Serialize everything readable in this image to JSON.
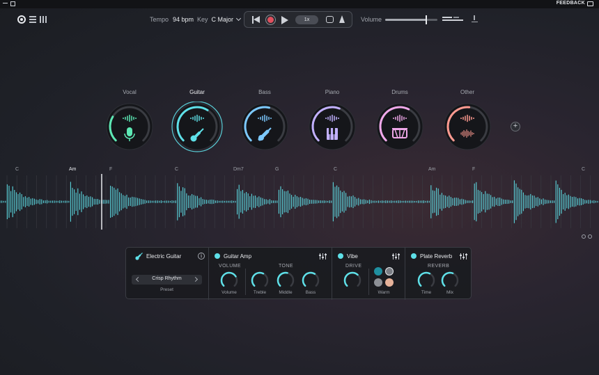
{
  "colors": {
    "accent_cyan": "#5ee0e8",
    "record_red": "#e0505e",
    "vocal": "#5de8b4",
    "guitar": "#5ee0e8",
    "bass": "#7cc9ff",
    "piano": "#c2b0ff",
    "drums": "#f0a8ea",
    "other": "#ff9a90"
  },
  "titlebar": {
    "feedback_label": "FEEDBACK"
  },
  "header": {
    "tempo_label": "Tempo",
    "tempo_value": "94 bpm",
    "key_label": "Key",
    "key_value": "C Major",
    "speed_label": "1x",
    "volume_label": "Volume",
    "volume_level": 0.78
  },
  "tracks": [
    {
      "name": "Vocal",
      "icon": "microphone-icon",
      "color": "#5de8b4",
      "level": 0.28,
      "active": false
    },
    {
      "name": "Guitar",
      "icon": "guitar-icon",
      "color": "#5ee0e8",
      "level": 0.62,
      "active": true
    },
    {
      "name": "Bass",
      "icon": "bass-guitar-icon",
      "color": "#7cc9ff",
      "level": 0.55,
      "active": false
    },
    {
      "name": "Piano",
      "icon": "piano-icon",
      "color": "#c2b0ff",
      "level": 0.58,
      "active": false
    },
    {
      "name": "Drums",
      "icon": "drum-icon",
      "color": "#f0a8ea",
      "level": 0.6,
      "active": false
    },
    {
      "name": "Other",
      "icon": "waveform-icon",
      "color": "#ff9a90",
      "level": 0.52,
      "active": false
    }
  ],
  "chords": [
    "C",
    "Am",
    "F",
    "C",
    "Dm7",
    "G",
    "C",
    "Am",
    "F",
    "C"
  ],
  "current_chord_index": 1,
  "instrument": {
    "name": "Electric Guitar",
    "preset_value": "Crisp Rhythm",
    "preset_label": "Preset"
  },
  "guitar_amp": {
    "title": "Guitar Amp",
    "volume_group": "VOLUME",
    "tone_group": "TONE",
    "knobs": [
      {
        "label": "Volume",
        "value": 0.72
      },
      {
        "label": "Treble",
        "value": 0.6
      },
      {
        "label": "Middle",
        "value": 0.55
      },
      {
        "label": "Bass",
        "value": 0.62
      }
    ]
  },
  "vibe": {
    "title": "Vibe",
    "drive_group": "DRIVE",
    "drive_value": 0.66,
    "warm_label": "Warm",
    "swatches": [
      "#1f8fa0",
      "#7a7d84",
      "#8d9096",
      "#e6b29a"
    ]
  },
  "plate_reverb": {
    "title": "Plate Reverb",
    "reverb_group": "REVERB",
    "knobs": [
      {
        "label": "Time",
        "value": 0.6
      },
      {
        "label": "Mix",
        "value": 0.58
      }
    ]
  }
}
